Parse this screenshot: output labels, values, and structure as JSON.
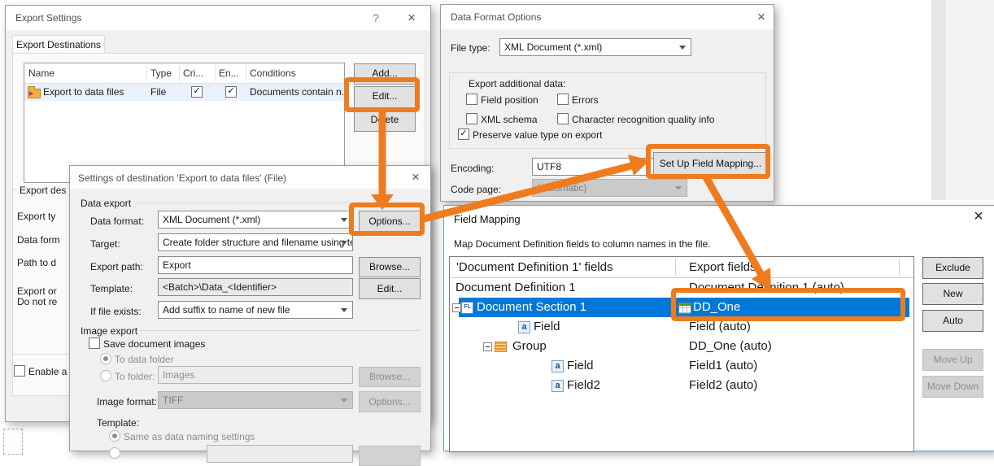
{
  "annotation": {
    "highlight_color": "#ee7c1f"
  },
  "export_settings": {
    "title": "Export Settings",
    "help_icon": "?",
    "close_icon": "×",
    "tab": "Export Destinations",
    "table": {
      "columns": {
        "name": "Name",
        "type": "Type",
        "critical": "Cri...",
        "enabled": "En...",
        "conditions": "Conditions"
      },
      "row": {
        "name": "Export to data files",
        "type": "File",
        "critical_checked": "✓",
        "enabled_checked": "✓",
        "conditions": "Documents contain n..."
      }
    },
    "buttons": {
      "add": "Add...",
      "edit": "Edit...",
      "delete": "Delete"
    },
    "clipped": {
      "group": "Export des",
      "row1": "Export ty",
      "row2": "Data form",
      "row3": "Path to d",
      "row4": "Export or",
      "row5": "Do not re",
      "enable_label": "Enable a"
    }
  },
  "data_format_options": {
    "title": "Data Format Options",
    "close_icon": "×",
    "file_type_label": "File type:",
    "file_type_value": "XML Document (*.xml)",
    "group_label": "Export additional data:",
    "checks": [
      {
        "label": "Field position"
      },
      {
        "label": "Errors"
      },
      {
        "label": "XML schema"
      },
      {
        "label": "Character recognition quality info"
      }
    ],
    "preserve": {
      "label": "Preserve value type on export",
      "mark": "✓"
    },
    "encoding_label": "Encoding:",
    "encoding_value": "UTF8",
    "codepage_label": "Code page:",
    "codepage_value": "(Automatic)",
    "setup_button": "Set Up Field Mapping..."
  },
  "destination_settings": {
    "title": "Settings of destination 'Export to data files' (File)",
    "close_icon": "×",
    "data_export_group": "Data export",
    "data_format_label": "Data format:",
    "data_format_value": "XML Document (*.xml)",
    "options_button": "Options...",
    "target_label": "Target:",
    "target_value": "Create folder structure and filename using ter",
    "export_path_label": "Export path:",
    "export_path_value": "Export",
    "browse_button": "Browse...",
    "template_label": "Template:",
    "template_value": "<Batch>\\Data_<Identifier>",
    "edit_button": "Edit...",
    "if_file_exists_label": "If file exists:",
    "if_file_exists_value": "Add suffix to name of new file",
    "image_export_group": "Image export",
    "save_images_label": "Save document images",
    "to_data_folder_label": "To data folder",
    "to_folder_label": "To folder:",
    "to_folder_value": "Images",
    "browse2_button": "Browse...",
    "image_format_label": "Image format:",
    "image_format_value": "TIFF",
    "options2_button": "Options...",
    "template2_label": "Template:",
    "same_as_label": "Same as data naming settings"
  },
  "field_mapping": {
    "title": "Field Mapping",
    "close_icon": "×",
    "instruction": "Map Document Definition fields to column names in the file.",
    "col1_header": "'Document Definition 1' fields",
    "col2_header": "Export fields",
    "rows": [
      {
        "field": "Document Definition 1",
        "export": "Document Definition 1 (auto)"
      },
      {
        "field": "Document Section 1",
        "export": "DD_One"
      },
      {
        "field": "Field",
        "export": "Field (auto)"
      },
      {
        "field": "Group",
        "export": "DD_One (auto)"
      },
      {
        "field": "Field",
        "export": "Field1 (auto)"
      },
      {
        "field": "Field2",
        "export": "Field2 (auto)"
      }
    ],
    "icons": {
      "fl_badge": "FL",
      "a_badge": "a"
    },
    "buttons": {
      "exclude": "Exclude",
      "new": "New",
      "auto": "Auto",
      "move_up": "Move Up",
      "move_down": "Move Down"
    }
  }
}
